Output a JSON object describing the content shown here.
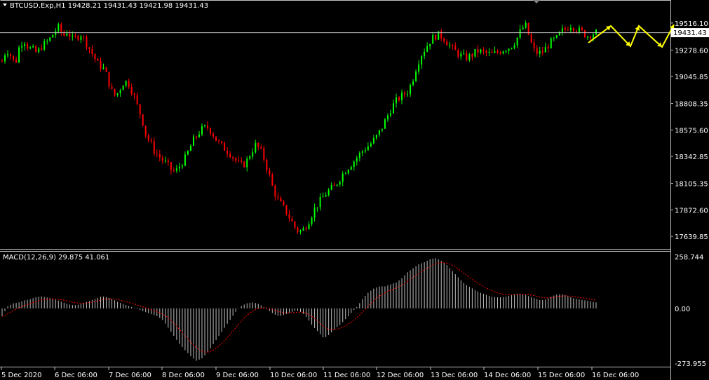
{
  "header": {
    "symbol_line": "BTCUSD.Exp,H1  19428.21 19431.43 19421.98 19431.43",
    "current_price_label": "19431.43"
  },
  "macd": {
    "label": "MACD(12,26,9) 29.875 41.061"
  },
  "colors": {
    "background": "#000000",
    "bull": "#00ff00",
    "bear": "#ff0000",
    "grid": "#c0c0c0",
    "axis_text": "#ffffff",
    "signal_line": "#ff0000",
    "histogram": "#c0c0c0",
    "arrows": "#ffff00"
  },
  "chart_data": [
    {
      "type": "candlestick",
      "title": "BTCUSD.Exp,H1",
      "ylim": [
        17560,
        19620
      ],
      "y_ticks": [
        "19516.10",
        "19278.60",
        "19045.85",
        "18808.35",
        "18575.60",
        "18342.85",
        "18105.35",
        "17872.60",
        "17639.85"
      ],
      "current_price": 19431.43,
      "ohlc_last": {
        "open": 19428.21,
        "high": 19431.43,
        "low": 19421.98,
        "close": 19431.43
      },
      "x_labels": [
        "5 Dec 2020",
        "6 Dec 06:00",
        "7 Dec 06:00",
        "8 Dec 06:00",
        "9 Dec 06:00",
        "10 Dec 06:00",
        "11 Dec 06:00",
        "12 Dec 06:00",
        "13 Dec 06:00",
        "14 Dec 06:00",
        "15 Dec 06:00",
        "16 Dec 06:00"
      ],
      "close_path": [
        19180,
        19290,
        19230,
        19150,
        19320,
        19370,
        19300,
        19280,
        19250,
        19310,
        19340,
        19380,
        19440,
        19480,
        19400,
        19450,
        19370,
        19390,
        19420,
        19360,
        19290,
        19220,
        19150,
        19130,
        19050,
        18920,
        18870,
        18940,
        19010,
        18980,
        18900,
        18780,
        18680,
        18520,
        18460,
        18380,
        18340,
        18300,
        18260,
        18210,
        18220,
        18280,
        18330,
        18420,
        18500,
        18550,
        18590,
        18600,
        18560,
        18490,
        18440,
        18410,
        18380,
        18330,
        18280,
        18260,
        18300,
        18380,
        18440,
        18410,
        18320,
        18200,
        18060,
        17970,
        17910,
        17860,
        17790,
        17720,
        17680,
        17700,
        17760,
        17840,
        17910,
        17960,
        18010,
        18050,
        18070,
        18130,
        18190,
        18240,
        18280,
        18320,
        18370,
        18410,
        18440,
        18480,
        18530,
        18600,
        18680,
        18760,
        18820,
        18860,
        18890,
        18920,
        19020,
        19150,
        19240,
        19300,
        19360,
        19400,
        19410,
        19390,
        19340,
        19290,
        19260,
        19230,
        19210,
        19220,
        19250,
        19270,
        19260,
        19250,
        19240,
        19250,
        19270,
        19290,
        19300,
        19330,
        19390,
        19470,
        19490,
        19350,
        19260,
        19250,
        19270,
        19320,
        19360,
        19380,
        19440,
        19460,
        19500,
        19480,
        19450,
        19430,
        19400,
        19420,
        19431
      ]
    },
    {
      "type": "bar",
      "title": "MACD(12,26,9)",
      "ylim": [
        -273.955,
        258.744
      ],
      "y_ticks": [
        "258.744",
        "0.00",
        "-273.955"
      ],
      "macd_main": 29.875,
      "macd_signal": 41.061,
      "histogram_path": [
        -40,
        10,
        25,
        30,
        40,
        45,
        55,
        60,
        55,
        50,
        40,
        30,
        20,
        15,
        20,
        30,
        40,
        50,
        60,
        55,
        45,
        30,
        20,
        10,
        0,
        -10,
        -20,
        -30,
        -40,
        -60,
        -100,
        -140,
        -180,
        -210,
        -240,
        -262,
        -250,
        -220,
        -180,
        -140,
        -100,
        -60,
        -20,
        10,
        25,
        30,
        25,
        10,
        -10,
        -30,
        -40,
        -30,
        -20,
        -10,
        -20,
        -50,
        -90,
        -120,
        -150,
        -130,
        -100,
        -80,
        -50,
        -20,
        10,
        50,
        80,
        100,
        110,
        110,
        120,
        130,
        150,
        180,
        200,
        220,
        230,
        245,
        252,
        240,
        220,
        190,
        160,
        130,
        110,
        95,
        80,
        70,
        60,
        55,
        55,
        60,
        70,
        75,
        70,
        60,
        50,
        40,
        45,
        60,
        70,
        70,
        60,
        50,
        45,
        40,
        35,
        30
      ]
    }
  ]
}
